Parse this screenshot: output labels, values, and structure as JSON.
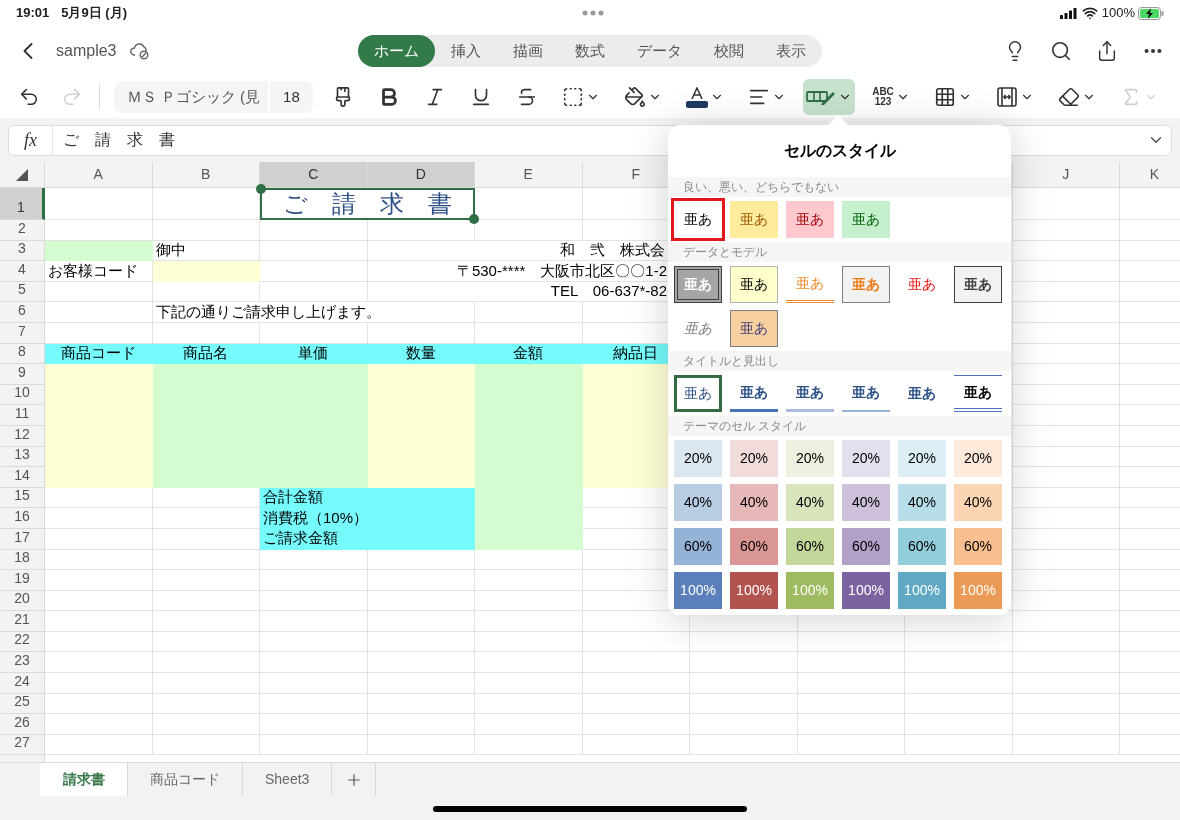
{
  "status_bar": {
    "time": "19:01",
    "date": "5月9日 (月)",
    "battery": "100%"
  },
  "title_bar": {
    "file_name": "sample3"
  },
  "ribbon_tabs": [
    {
      "label": "ホーム",
      "selected": true
    },
    {
      "label": "挿入",
      "selected": false
    },
    {
      "label": "描画",
      "selected": false
    },
    {
      "label": "数式",
      "selected": false
    },
    {
      "label": "データ",
      "selected": false
    },
    {
      "label": "校閲",
      "selected": false
    },
    {
      "label": "表示",
      "selected": false
    }
  ],
  "toolbar": {
    "history": [
      {
        "kind": "undo",
        "disabled": false
      },
      {
        "kind": "redo",
        "disabled": true
      }
    ],
    "font": "ＭＳ Ｐゴシック (見",
    "size": "18",
    "buttons": [
      {
        "kind": "format_painter",
        "selected": false,
        "disabled": false
      },
      {
        "kind": "bold",
        "selected": false,
        "disabled": false
      },
      {
        "kind": "italic",
        "selected": false,
        "disabled": false
      },
      {
        "kind": "underline",
        "selected": false,
        "disabled": false
      },
      {
        "kind": "strikethrough",
        "selected": false,
        "disabled": false
      },
      {
        "kind": "borders",
        "selected": false,
        "disabled": false
      },
      {
        "kind": "fill_color",
        "selected": false,
        "disabled": false
      },
      {
        "kind": "font_color",
        "selected": false,
        "disabled": false
      },
      {
        "kind": "align",
        "selected": false,
        "disabled": false
      },
      {
        "kind": "cell_styles",
        "selected": true,
        "disabled": false
      },
      {
        "kind": "number_format",
        "selected": false,
        "disabled": false,
        "lines": [
          "ABC",
          "123"
        ]
      },
      {
        "kind": "table",
        "selected": false,
        "disabled": false
      },
      {
        "kind": "fit",
        "selected": false,
        "disabled": false
      },
      {
        "kind": "eraser",
        "selected": false,
        "disabled": false
      },
      {
        "kind": "autosum",
        "selected": false,
        "disabled": true
      }
    ]
  },
  "formula_bar": {
    "label": "fx",
    "value": "ご　請　求　書"
  },
  "sheet": {
    "columns": [
      {
        "label": "A",
        "selected": false
      },
      {
        "label": "B",
        "selected": false
      },
      {
        "label": "C",
        "selected": true
      },
      {
        "label": "D",
        "selected": true
      },
      {
        "label": "E",
        "selected": false
      },
      {
        "label": "F",
        "selected": false
      },
      {
        "label": "J",
        "selected": false
      },
      {
        "label": "K",
        "selected": false
      }
    ],
    "rows": [
      {
        "label": "1",
        "selected": true
      },
      {
        "label": "2",
        "selected": false
      },
      {
        "label": "3",
        "selected": false
      },
      {
        "label": "4",
        "selected": false
      },
      {
        "label": "5",
        "selected": false
      },
      {
        "label": "6",
        "selected": false
      },
      {
        "label": "7",
        "selected": false
      },
      {
        "label": "8",
        "selected": false
      },
      {
        "label": "9",
        "selected": false
      },
      {
        "label": "10",
        "selected": false
      },
      {
        "label": "11",
        "selected": false
      },
      {
        "label": "12",
        "selected": false
      },
      {
        "label": "13",
        "selected": false
      },
      {
        "label": "14",
        "selected": false
      },
      {
        "label": "15",
        "selected": false
      },
      {
        "label": "16",
        "selected": false
      },
      {
        "label": "17",
        "selected": false
      },
      {
        "label": "18",
        "selected": false
      },
      {
        "label": "19",
        "selected": false
      },
      {
        "label": "20",
        "selected": false
      },
      {
        "label": "21",
        "selected": false
      },
      {
        "label": "22",
        "selected": false
      },
      {
        "label": "23",
        "selected": false
      },
      {
        "label": "24",
        "selected": false
      },
      {
        "label": "25",
        "selected": false
      },
      {
        "label": "26",
        "selected": false
      },
      {
        "label": "27",
        "selected": false
      }
    ],
    "title": "ご　請　求　書",
    "addressee": "御中",
    "customer_code": "お客様コード",
    "company": "和　弐　株式会",
    "address": "〒530-****　大阪市北区〇〇1-2",
    "tel": "TEL　06-637*-82",
    "greeting": "下記の通りご請求申し上げます。",
    "table_headers": [
      "商品コード",
      "商品名",
      "単価",
      "数量",
      "金額",
      "納品日"
    ],
    "totals": [
      "合計金額",
      "消費税（10%）",
      "ご請求金額"
    ]
  },
  "cell_styles_popup": {
    "title": "セルのスタイル",
    "sections": [
      {
        "title": "良い、悪い、どちらでもない",
        "swatches": [
          {
            "label": "亜あ",
            "kind": "normal",
            "selected": false,
            "highlighted": true
          },
          {
            "label": "亜あ",
            "kind": "neutral",
            "selected": false,
            "highlighted": false
          },
          {
            "label": "亜あ",
            "kind": "bad",
            "selected": false,
            "highlighted": false
          },
          {
            "label": "亜あ",
            "kind": "good",
            "selected": false,
            "highlighted": false
          }
        ]
      },
      {
        "title": "データとモデル",
        "swatches": [
          {
            "label": "亜あ",
            "kind": "check",
            "selected": false,
            "highlighted": false
          },
          {
            "label": "亜あ",
            "kind": "note",
            "selected": false,
            "highlighted": false
          },
          {
            "label": "亜あ",
            "kind": "linked",
            "selected": false,
            "highlighted": false
          },
          {
            "label": "亜あ",
            "kind": "calculation",
            "selected": false,
            "highlighted": false
          },
          {
            "label": "亜あ",
            "kind": "warning",
            "selected": false,
            "highlighted": false
          },
          {
            "label": "亜あ",
            "kind": "output",
            "selected": false,
            "highlighted": false
          },
          {
            "label": "亜あ",
            "kind": "explanatory",
            "selected": false,
            "highlighted": false
          },
          {
            "label": "亜あ",
            "kind": "input",
            "selected": false,
            "highlighted": false
          }
        ]
      },
      {
        "title": "タイトルと見出し",
        "swatches": [
          {
            "label": "亜あ",
            "kind": "title",
            "selected": true,
            "highlighted": false
          },
          {
            "label": "亜あ",
            "kind": "heading1",
            "selected": false,
            "highlighted": false
          },
          {
            "label": "亜あ",
            "kind": "heading2",
            "selected": false,
            "highlighted": false
          },
          {
            "label": "亜あ",
            "kind": "heading3",
            "selected": false,
            "highlighted": false
          },
          {
            "label": "亜あ",
            "kind": "heading4",
            "selected": false,
            "highlighted": false
          },
          {
            "label": "亜あ",
            "kind": "total",
            "selected": false,
            "highlighted": false
          }
        ]
      },
      {
        "title": "テーマのセル スタイル",
        "swatches": [
          {
            "label": "20%",
            "kind": "theme",
            "color": "#dce6f1",
            "selected": false,
            "highlighted": false
          },
          {
            "label": "20%",
            "kind": "theme",
            "color": "#f2dcdb",
            "selected": false,
            "highlighted": false
          },
          {
            "label": "20%",
            "kind": "theme",
            "color": "#ebf1de",
            "selected": false,
            "highlighted": false
          },
          {
            "label": "20%",
            "kind": "theme",
            "color": "#e4dfec",
            "selected": false,
            "highlighted": false
          },
          {
            "label": "20%",
            "kind": "theme",
            "color": "#daeef3",
            "selected": false,
            "highlighted": false
          },
          {
            "label": "20%",
            "kind": "theme",
            "color": "#fde9d9",
            "selected": false,
            "highlighted": false
          },
          {
            "label": "40%",
            "kind": "theme",
            "color": "#b8cce4",
            "selected": false,
            "highlighted": false
          },
          {
            "label": "40%",
            "kind": "theme",
            "color": "#e6b8b7",
            "selected": false,
            "highlighted": false
          },
          {
            "label": "40%",
            "kind": "theme",
            "color": "#d8e4bc",
            "selected": false,
            "highlighted": false
          },
          {
            "label": "40%",
            "kind": "theme",
            "color": "#ccc0da",
            "selected": false,
            "highlighted": false
          },
          {
            "label": "40%",
            "kind": "theme",
            "color": "#b7dee8",
            "selected": false,
            "highlighted": false
          },
          {
            "label": "40%",
            "kind": "theme",
            "color": "#fcd5b4",
            "selected": false,
            "highlighted": false
          },
          {
            "label": "60%",
            "kind": "theme",
            "color": "#95b3d7",
            "selected": false,
            "highlighted": false
          },
          {
            "label": "60%",
            "kind": "theme",
            "color": "#da9694",
            "selected": false,
            "highlighted": false
          },
          {
            "label": "60%",
            "kind": "theme",
            "color": "#c4d79b",
            "selected": false,
            "highlighted": false
          },
          {
            "label": "60%",
            "kind": "theme",
            "color": "#b1a0c7",
            "selected": false,
            "highlighted": false
          },
          {
            "label": "60%",
            "kind": "theme",
            "color": "#92cddc",
            "selected": false,
            "highlighted": false
          },
          {
            "label": "60%",
            "kind": "theme",
            "color": "#fabf8f",
            "selected": false,
            "highlighted": false
          },
          {
            "label": "100%",
            "kind": "theme_dark",
            "color": "#5a7fba",
            "selected": false,
            "highlighted": false
          },
          {
            "label": "100%",
            "kind": "theme_dark",
            "color": "#b3534f",
            "selected": false,
            "highlighted": false
          },
          {
            "label": "100%",
            "kind": "theme_dark",
            "color": "#9fbb62",
            "selected": false,
            "highlighted": false
          },
          {
            "label": "100%",
            "kind": "theme_dark",
            "color": "#7b62a0",
            "selected": false,
            "highlighted": false
          },
          {
            "label": "100%",
            "kind": "theme_dark",
            "color": "#5fa9c4",
            "selected": false,
            "highlighted": false
          },
          {
            "label": "100%",
            "kind": "theme_dark",
            "color": "#ea9a55",
            "selected": false,
            "highlighted": false
          }
        ]
      }
    ]
  },
  "sheet_tabs": [
    {
      "label": "請求書",
      "selected": true
    },
    {
      "label": "商品コード",
      "selected": false
    },
    {
      "label": "Sheet3",
      "selected": false
    }
  ]
}
